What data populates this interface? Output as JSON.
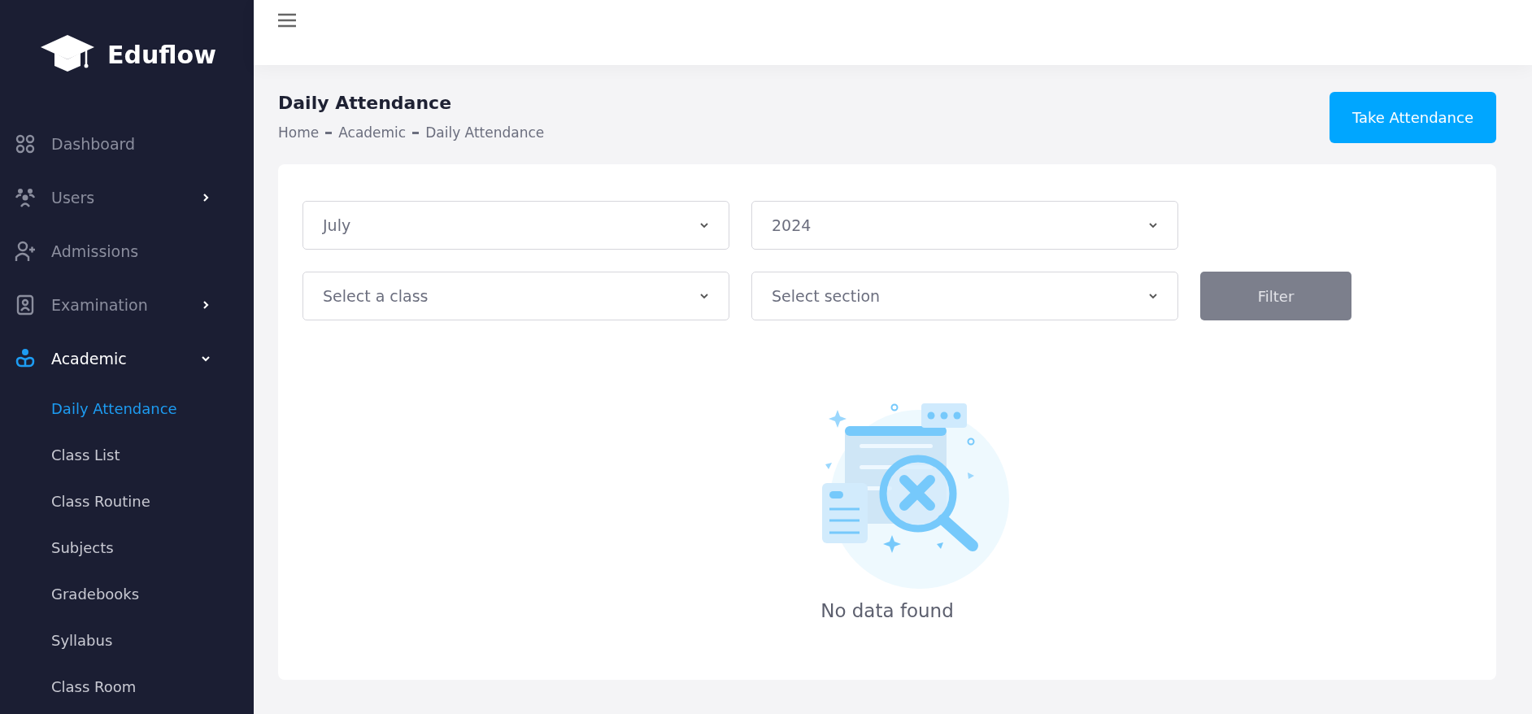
{
  "brand": {
    "name": "Eduflow"
  },
  "sidebar": {
    "items": [
      {
        "label": "Dashboard",
        "kind": "grid",
        "selected": false,
        "has_children": false
      },
      {
        "label": "Users",
        "kind": "users",
        "expanded": false,
        "selected": false,
        "has_children": true
      },
      {
        "label": "Admissions",
        "kind": "user-plus",
        "selected": false,
        "has_children": false
      },
      {
        "label": "Examination",
        "kind": "badge",
        "expanded": false,
        "selected": false,
        "has_children": true
      },
      {
        "label": "Academic",
        "kind": "reader",
        "expanded": true,
        "selected": true,
        "has_children": true,
        "children": [
          {
            "label": "Daily Attendance",
            "selected": true
          },
          {
            "label": "Class List",
            "selected": false
          },
          {
            "label": "Class Routine",
            "selected": false
          },
          {
            "label": "Subjects",
            "selected": false
          },
          {
            "label": "Gradebooks",
            "selected": false
          },
          {
            "label": "Syllabus",
            "selected": false
          },
          {
            "label": "Class Room",
            "selected": false
          }
        ]
      }
    ]
  },
  "page": {
    "title": "Daily Attendance",
    "breadcrumb": [
      "Home",
      "Academic",
      "Daily Attendance"
    ],
    "action_button": "Take Attendance"
  },
  "filters": {
    "rows": [
      [
        {
          "value": "July"
        },
        {
          "value": "2024"
        }
      ],
      [
        {
          "placeholder": "Select a class"
        },
        {
          "placeholder": "Select section"
        }
      ]
    ],
    "button": {
      "label": "Filter",
      "disabled": true
    }
  },
  "empty_state": {
    "message": "No data found"
  }
}
